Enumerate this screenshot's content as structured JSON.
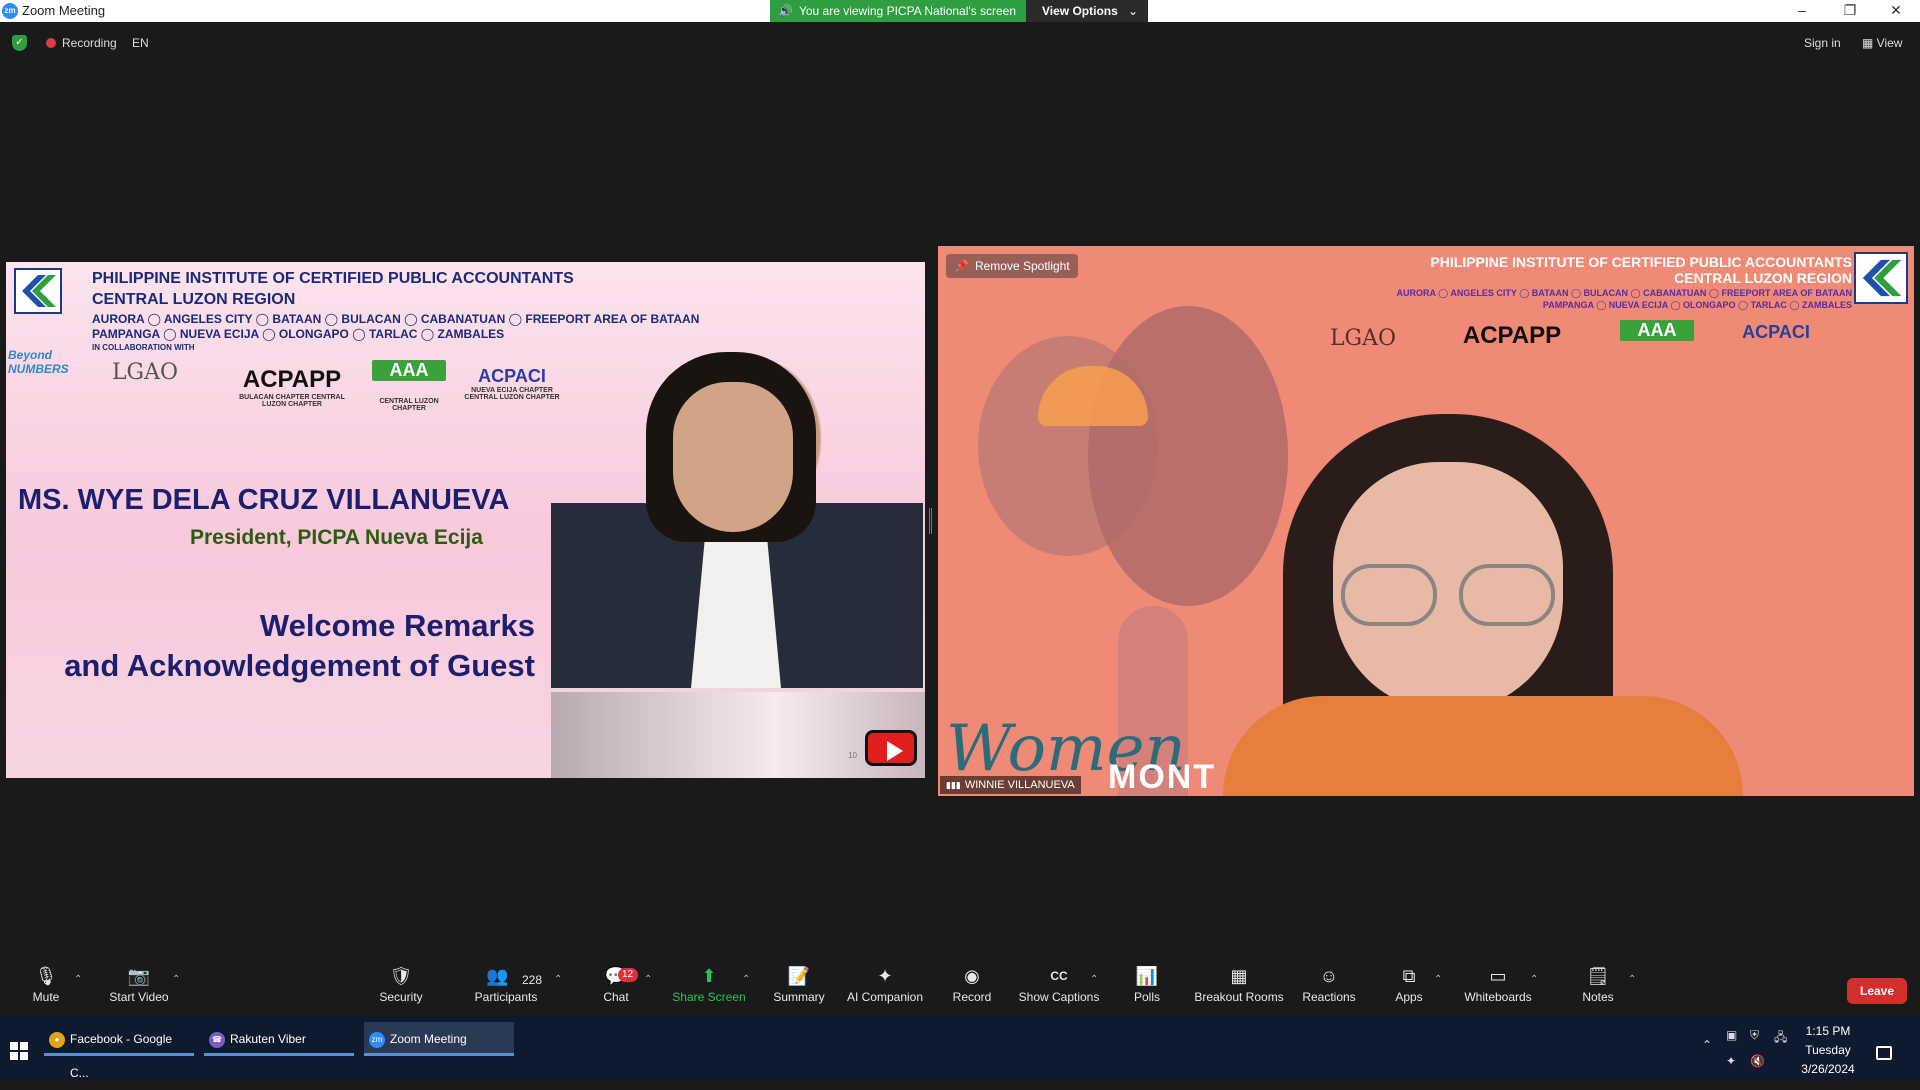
{
  "window": {
    "title": "Zoom Meeting",
    "app_icon": "zm",
    "viewing_banner": "You are viewing PICPA National's screen",
    "view_options_label": "View Options",
    "minimize": "–",
    "restore": "❐",
    "close": "✕"
  },
  "topbar": {
    "recording_label": "Recording",
    "language": "EN",
    "sign_in": "Sign in",
    "view": "View"
  },
  "left_slide": {
    "org_line1": "PHILIPPINE INSTITUTE OF CERTIFIED PUBLIC ACCOUNTANTS",
    "org_line2": "CENTRAL LUZON REGION",
    "towns_line1": "AURORA ◯ ANGELES CITY ◯ BATAAN ◯ BULACAN ◯ CABANATUAN ◯ FREEPORT AREA OF BATAAN",
    "towns_line2": "PAMPANGA ◯ NUEVA ECIJA ◯ OLONGAPO ◯ TARLAC ◯ ZAMBALES",
    "collab": "IN COLLABORATION WITH",
    "beyond_numbers": "Beyond NUMBERS",
    "partners": [
      {
        "name": "LGAO",
        "sub": ""
      },
      {
        "name": "ACPAPP",
        "sub": "BULACAN CHAPTER CENTRAL LUZON CHAPTER"
      },
      {
        "name": "AAA",
        "sub": "CENTRAL LUZON CHAPTER"
      },
      {
        "name": "ACPACI",
        "sub": "NUEVA ECIJA CHAPTER CENTRAL LUZON CHAPTER"
      }
    ],
    "speaker_name": "MS. WYE DELA CRUZ VILLANUEVA",
    "speaker_role": "President, PICPA Nueva Ecija",
    "remarks_line1": "Welcome Remarks",
    "remarks_line2": "and Acknowledgement of Guest",
    "video_counter": "10"
  },
  "right_video": {
    "spotlight_label": "Remove Spotlight",
    "org_line1": "PHILIPPINE INSTITUTE OF CERTIFIED PUBLIC ACCOUNTANTS",
    "org_line2": "CENTRAL LUZON REGION",
    "towns_line1": "AURORA ◯ ANGELES CITY ◯ BATAAN ◯ BULACAN ◯ CABANATUAN ◯ FREEPORT AREA OF BATAAN",
    "towns_line2": "PAMPANGA ◯ NUEVA ECIJA ◯ OLONGAPO ◯ TARLAC ◯ ZAMBALES",
    "partners": [
      "LGAO",
      "ACPAPP",
      "AAA",
      "ACPACI"
    ],
    "women_text": "Women",
    "month_text": "MONT",
    "participant_name": "WINNIE VILLANUEVA"
  },
  "controls": {
    "mute": "Mute",
    "start_video": "Start Video",
    "security": "Security",
    "participants": "Participants",
    "participants_count": "228",
    "chat": "Chat",
    "chat_badge": "12",
    "share_screen": "Share Screen",
    "summary": "Summary",
    "ai_companion": "AI Companion",
    "record": "Record",
    "show_captions": "Show Captions",
    "polls": "Polls",
    "breakout_rooms": "Breakout Rooms",
    "reactions": "Reactions",
    "apps": "Apps",
    "whiteboards": "Whiteboards",
    "notes": "Notes",
    "leave": "Leave"
  },
  "taskbar": {
    "tasks": [
      {
        "label": "Facebook - Google C...",
        "icon": "chrome-icon"
      },
      {
        "label": "Rakuten Viber",
        "icon": "viber-icon"
      },
      {
        "label": "Zoom Meeting",
        "icon": "zoom-icon"
      }
    ],
    "time": "1:15 PM",
    "day": "Tuesday",
    "date": "3/26/2024"
  },
  "colors": {
    "zoom_blue": "#2d8cff",
    "banner_green": "#2e9e41",
    "share_green": "#26c25a",
    "leave_red": "#d32f2f",
    "slide_navy": "#1b1f6e",
    "taskbar": "#0e1b2e"
  }
}
